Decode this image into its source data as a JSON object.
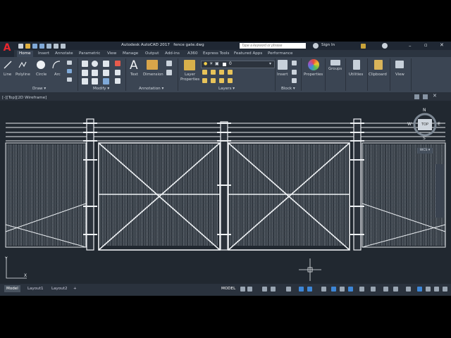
{
  "app": {
    "logo_letter": "A",
    "title": "Autodesk AutoCAD 2017",
    "filename": "fence gate.dwg",
    "search_placeholder": "Type a keyword or phrase",
    "signin_label": "Sign In"
  },
  "ribbon_tabs": [
    "Home",
    "Insert",
    "Annotate",
    "Parametric",
    "View",
    "Manage",
    "Output",
    "Add-ins",
    "A360",
    "Express Tools",
    "Featured Apps",
    "Performance"
  ],
  "draw_panel": {
    "title": "Draw ▾",
    "tools": [
      "Line",
      "Polyline",
      "Circle",
      "Arc"
    ]
  },
  "modify_panel": {
    "title": "Modify ▾"
  },
  "annotation_panel": {
    "title": "Annotation ▾",
    "tools": [
      "Text",
      "Dimension"
    ]
  },
  "layers_panel": {
    "title": "Layers ▾",
    "tool_line1": "Layer",
    "tool_line2": "Properties",
    "layer_current": "0"
  },
  "block_panel": {
    "title": "Block ▾",
    "tool": "Insert"
  },
  "right_tools": [
    "Properties",
    "Groups",
    "Utilities",
    "Clipboard",
    "View"
  ],
  "viewport": {
    "label": "[-][Top][2D Wireframe]"
  },
  "viewcube": {
    "north": "N",
    "south": "S",
    "east": "E",
    "west": "W",
    "top": "TOP",
    "wcs": "WCS ▾"
  },
  "ucs": {
    "y": "Y",
    "x": "X"
  },
  "layout_tabs": [
    "Model",
    "Layout1",
    "Layout2"
  ],
  "add_layout": "+",
  "status_model": "MODEL",
  "colors": {
    "accent": "#e8262e",
    "ribbon": "#3b4553",
    "canvas": "#212830",
    "lines": "#e6eaee"
  }
}
